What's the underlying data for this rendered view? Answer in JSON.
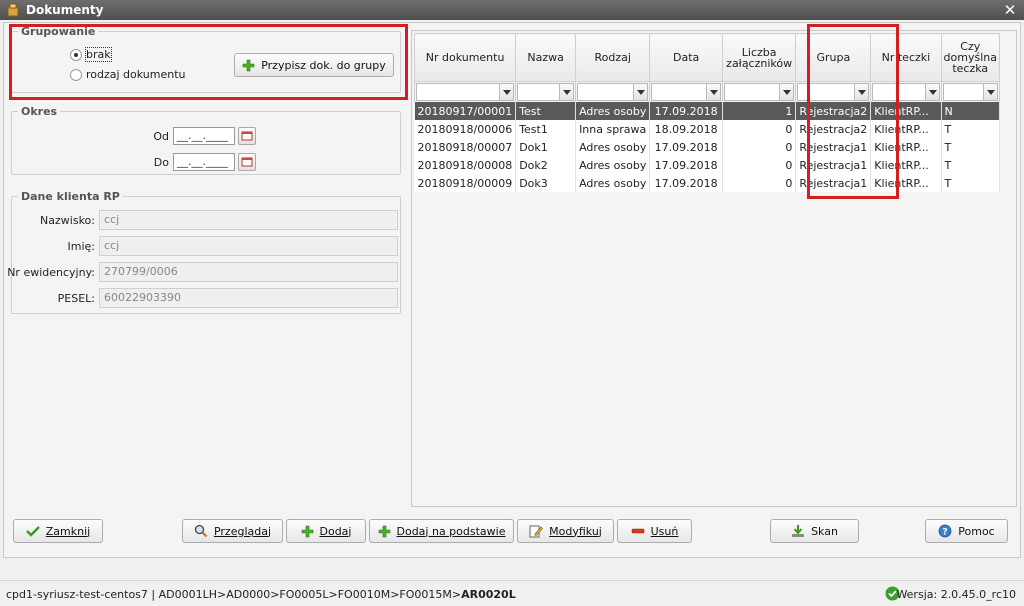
{
  "window": {
    "title": "Dokumenty"
  },
  "grouping": {
    "legend": "Grupowanie",
    "options": [
      {
        "label": "brak",
        "checked": true
      },
      {
        "label": "rodzaj dokumentu",
        "checked": false
      }
    ],
    "assign_button": "Przypisz dok. do grupy"
  },
  "period": {
    "legend": "Okres",
    "from_label": "Od",
    "to_label": "Do",
    "from_value": "__.__.____",
    "to_value": "__.__.____"
  },
  "client": {
    "legend": "Dane klienta RP",
    "fields": [
      {
        "label": "Nazwisko:",
        "value": "ccj"
      },
      {
        "label": "Imię:",
        "value": "ccj"
      },
      {
        "label": "Nr ewidencyjny:",
        "value": "270799/0006"
      },
      {
        "label": "PESEL:",
        "value": "60022903390"
      }
    ]
  },
  "grid": {
    "columns": [
      "Nr dokumentu",
      "Nazwa",
      "Rodzaj",
      "Data",
      "Liczba załączników",
      "Grupa",
      "Nr teczki",
      "Czy domyślna teczka"
    ],
    "rows": [
      [
        "20180917/00001",
        "Test",
        "Adres osoby",
        "17.09.2018",
        "1",
        "Rejestracja2",
        "KlientRP...",
        "N"
      ],
      [
        "20180918/00006",
        "Test1",
        "Inna sprawa",
        "18.09.2018",
        "0",
        "Rejestracja2",
        "KlientRP...",
        "T"
      ],
      [
        "20180918/00007",
        "Dok1",
        "Adres osoby",
        "17.09.2018",
        "0",
        "Rejestracja1",
        "KlientRP...",
        "T"
      ],
      [
        "20180918/00008",
        "Dok2",
        "Adres osoby",
        "17.09.2018",
        "0",
        "Rejestracja1",
        "KlientRP...",
        "T"
      ],
      [
        "20180918/00009",
        "Dok3",
        "Adres osoby",
        "17.09.2018",
        "0",
        "Rejestracja1",
        "KlientRP...",
        "T"
      ]
    ],
    "selected_row": 0
  },
  "buttons": {
    "close": "Zamknij",
    "browse": "Przeglądaj",
    "add": "Dodaj",
    "add_based": "Dodaj na podstawie",
    "modify": "Modyfikuj",
    "delete": "Usuń",
    "scan": "Skan",
    "help": "Pomoc"
  },
  "status": {
    "path_prefix": "cpd1-syriusz-test-centos7 | AD0001LH>AD0000>FO0005L>FO0010M>FO0015M>",
    "path_current": "AR0020L",
    "version": "Wersja: 2.0.45.0_rc10"
  },
  "colors": {
    "highlight": "#d41f1f",
    "selected_row": "#5a5a5a",
    "titlebar": "#5a5a5a"
  }
}
